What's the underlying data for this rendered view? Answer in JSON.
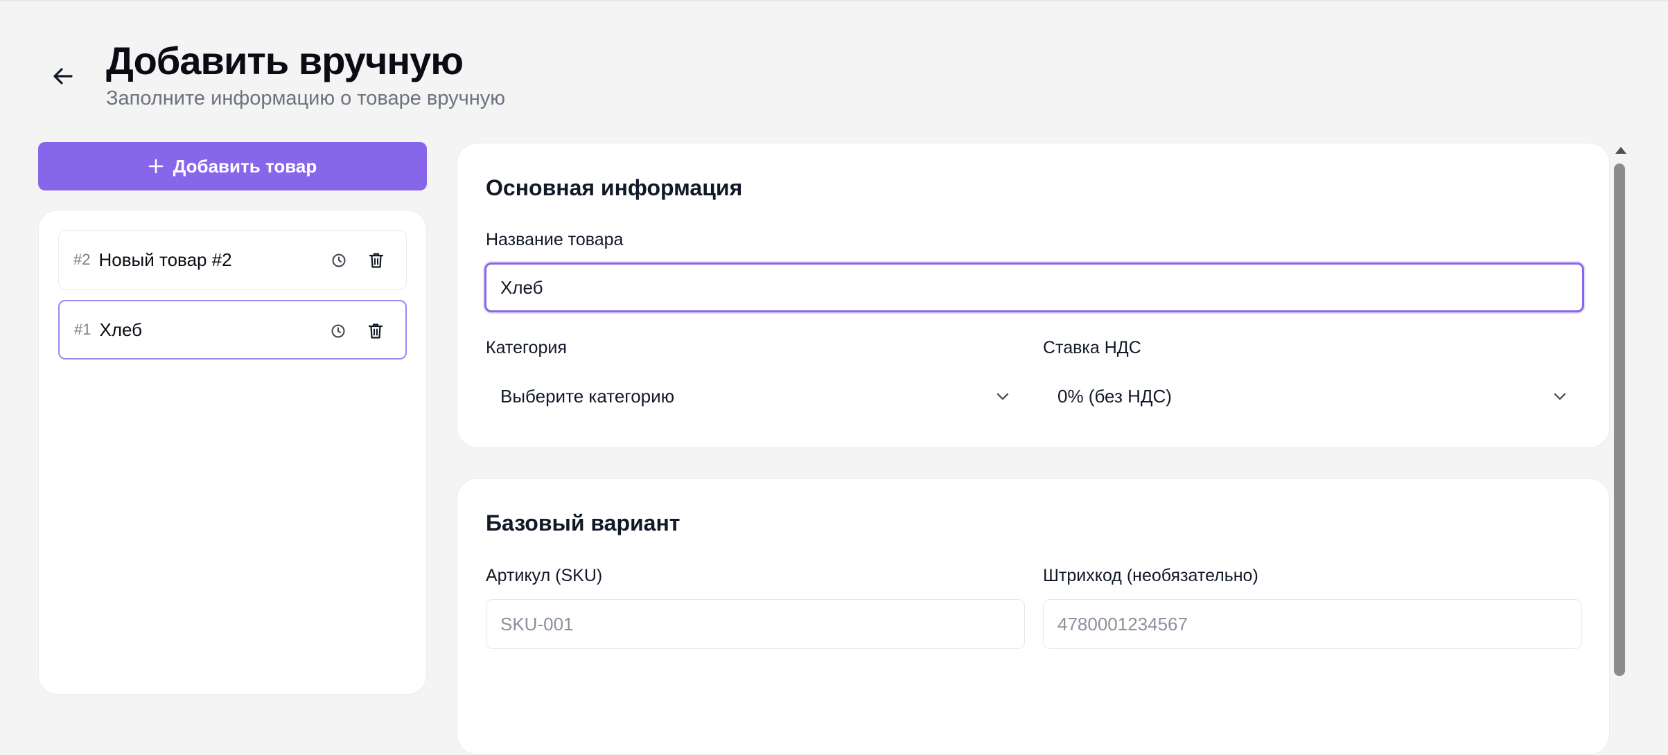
{
  "header": {
    "title": "Добавить вручную",
    "subtitle": "Заполните информацию о товаре вручную",
    "back_icon": "arrow-left-icon"
  },
  "sidebar": {
    "add_button_label": "Добавить товар",
    "add_icon": "plus-icon",
    "items": [
      {
        "number": "#2",
        "name": "Новый товар #2",
        "selected": false
      },
      {
        "number": "#1",
        "name": "Хлеб",
        "selected": true
      }
    ],
    "item_icons": [
      "clock-icon",
      "trash-icon"
    ]
  },
  "main_info": {
    "title": "Основная информация",
    "name_label": "Название товара",
    "name_value": "Хлеб",
    "category_label": "Категория",
    "category_value": "Выберите категорию",
    "vat_label": "Ставка НДС",
    "vat_value": "0% (без НДС)"
  },
  "base_variant": {
    "title": "Базовый вариант",
    "sku_label": "Артикул (SKU)",
    "sku_placeholder": "SKU-001",
    "barcode_label": "Штрихкод (необязательно)",
    "barcode_placeholder": "4780001234567"
  },
  "colors": {
    "accent": "#8766ea",
    "background": "#f4f4f5",
    "card": "#ffffff",
    "muted_text": "#6b7280"
  }
}
